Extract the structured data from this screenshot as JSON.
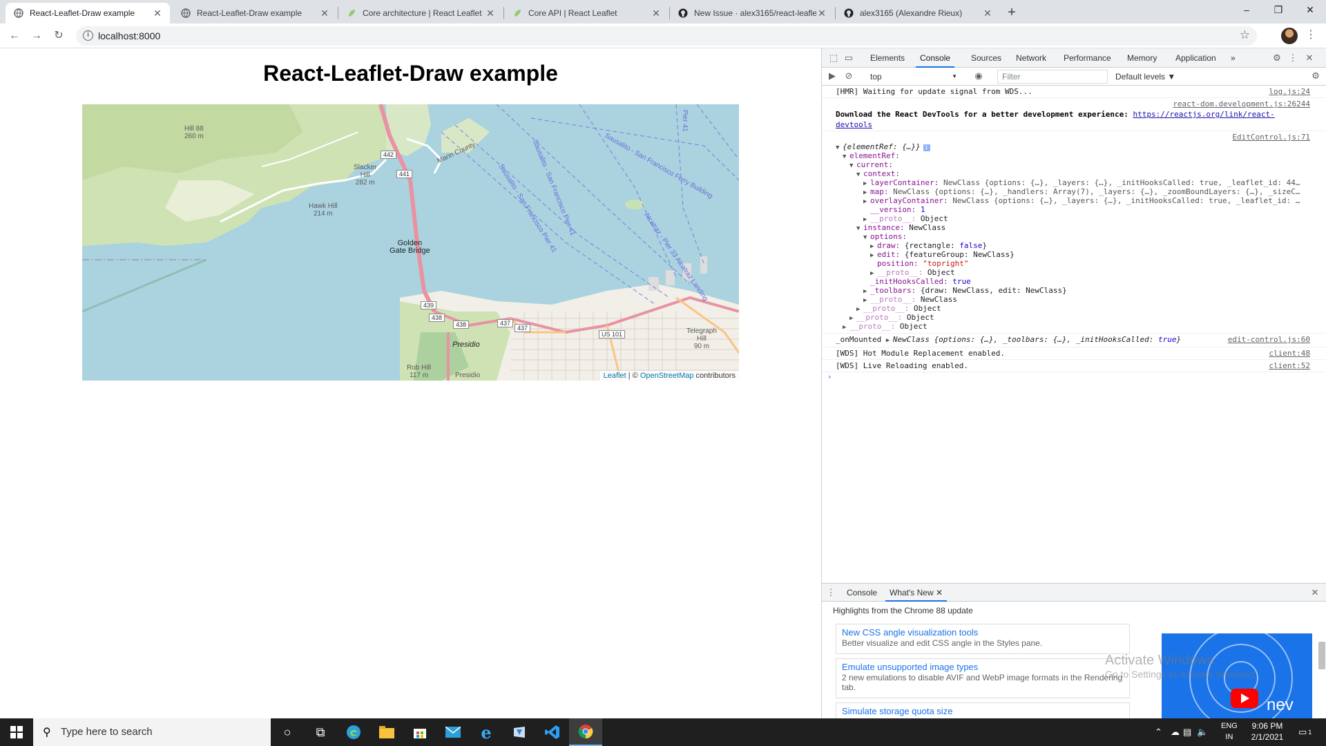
{
  "browser": {
    "tabs": [
      {
        "title": "React-Leaflet-Draw example",
        "icon": "globe-icon",
        "active": true
      },
      {
        "title": "React-Leaflet-Draw example",
        "icon": "globe-icon",
        "active": false
      },
      {
        "title": "Core architecture | React Leaflet",
        "icon": "leaf-icon",
        "active": false
      },
      {
        "title": "Core API | React Leaflet",
        "icon": "leaf-icon",
        "active": false
      },
      {
        "title": "New Issue · alex3165/react-leafle",
        "icon": "github-icon",
        "active": false
      },
      {
        "title": "alex3165 (Alexandre Rieux)",
        "icon": "github-icon",
        "active": false
      }
    ],
    "tab_close": "✕",
    "new_tab": "+",
    "window_controls": {
      "minimize": "–",
      "maximize": "❐",
      "close": "✕"
    },
    "url": "localhost:8000"
  },
  "page": {
    "title": "React-Leaflet-Draw example",
    "map": {
      "labels": {
        "hill88": "Hill 88",
        "hill88_elev": "260 m",
        "slacker": "Slacker",
        "slacker2": "Hill",
        "slacker_elev": "282 m",
        "hawk": "Hawk Hill",
        "hawk_elev": "214 m",
        "ggb1": "Golden",
        "ggb2": "Gate Bridge",
        "marin": "Marin County",
        "presidio": "Presidio",
        "presidio2": "Presidio",
        "rob_hill": "Rob Hill",
        "rob_elev": "117 m",
        "telegraph1": "Telegraph",
        "telegraph2": "Hill",
        "telegraph_elev": "90 m",
        "ferry1": "Sausalito - San Francisco Pier 41",
        "ferry2": "Sausalito - San Francisco Pier 41",
        "ferry3": "Sausalito - San Francisco Ferry Building",
        "ferry4": "Alcatraz - Pier 33 Alcatraz Landing",
        "pier41": "Pier 41"
      },
      "shields": {
        "r442": "442",
        "r441": "441",
        "r439": "439",
        "r438": "438",
        "r438b": "438",
        "r437": "437",
        "r437b": "437",
        "us101": "US 101"
      },
      "attribution": {
        "leaflet": "Leaflet",
        "sep": " | © ",
        "osm": "OpenStreetMap",
        "contrib": " contributors"
      }
    }
  },
  "devtools": {
    "tabs": [
      "Elements",
      "Console",
      "Sources",
      "Network",
      "Performance",
      "Memory",
      "Application"
    ],
    "active_tab": "Console",
    "more": "»",
    "context": "top",
    "filter_placeholder": "Filter",
    "levels": "Default levels ▼",
    "console": {
      "hmr": "[HMR] Waiting for update signal from WDS...",
      "hmr_src": "log.js:24",
      "rd_src": "react-dom.development.js:26244",
      "rd_msg": "Download the React DevTools for a better development experience: ",
      "rd_link": "https://reactjs.org/link/react-devtools",
      "ec_src": "EditControl.js:71",
      "tree": {
        "root": "{elementRef: {…}}",
        "elementRef": "elementRef:",
        "current": "current:",
        "context": "context:",
        "layerContainer_k": "layerContainer:",
        "layerContainer_v": "NewClass {options: {…}, _layers: {…}, _initHooksCalled: true, _leaflet_id: 44…",
        "map_k": "map:",
        "map_v": "NewClass {options: {…}, _handlers: Array(7), _layers: {…}, _zoomBoundLayers: {…}, _sizeC…",
        "overlay_k": "overlayContainer:",
        "overlay_v": "NewClass {options: {…}, _layers: {…}, _initHooksCalled: true, _leaflet_id: …",
        "version_k": "__version:",
        "version_v": "1",
        "proto_k": "__proto__:",
        "proto_obj": "Object",
        "instance_k": "instance:",
        "instance_v": "NewClass",
        "options_k": "options:",
        "draw_k": "draw:",
        "draw_v1": "{rectangle: ",
        "draw_v2": "false",
        "draw_v3": "}",
        "edit_k": "edit:",
        "edit_v": "{featureGroup: NewClass}",
        "position_k": "position:",
        "position_v": "\"topright\"",
        "inithooks_k": "_initHooksCalled:",
        "inithooks_v": "true",
        "toolbars_k": "_toolbars:",
        "toolbars_v": "{draw: NewClass, edit: NewClass}",
        "proto_newclass": "NewClass"
      },
      "mounted_k": "_onMounted",
      "mounted_v1": "NewClass {options: {…}, _toolbars: {…}, _initHooksCalled: ",
      "mounted_v2": "true",
      "mounted_v3": "}",
      "mounted_src": "edit-control.js:60",
      "wds1": "[WDS] Hot Module Replacement enabled.",
      "wds1_src": "client:48",
      "wds2": "[WDS] Live Reloading enabled.",
      "wds2_src": "client:52",
      "prompt": "›"
    },
    "drawer": {
      "tabs": [
        "Console",
        "What's New"
      ],
      "close_tab": "✕",
      "highlights": "Highlights from the Chrome 88 update",
      "cards": [
        {
          "title": "New CSS angle visualization tools",
          "desc": "Better visualize and edit CSS angle in the Styles pane."
        },
        {
          "title": "Emulate unsupported image types",
          "desc": "2 new emulations to disable AVIF and WebP image formats in the Rendering tab."
        },
        {
          "title": "Simulate storage quota size",
          "desc": ""
        }
      ],
      "promo_text": "nev",
      "activate1": "Activate Windows",
      "activate2": "Go to Settings to activate Windows."
    }
  },
  "taskbar": {
    "search_placeholder": "Type here to search",
    "lang1": "ENG",
    "lang2": "IN",
    "time": "9:06 PM",
    "date": "2/1/2021",
    "notification_count": "1"
  }
}
